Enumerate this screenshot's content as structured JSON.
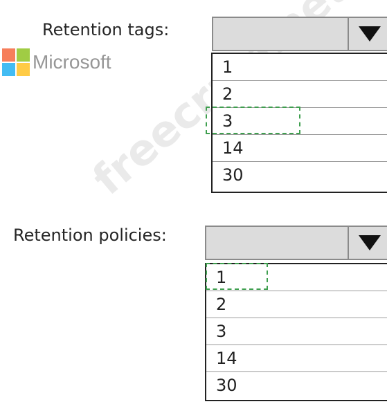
{
  "brand": {
    "text": "Microsoft"
  },
  "watermark": {
    "text": "freecram.net"
  },
  "retention_tags": {
    "label": "Retention tags:",
    "selected": "",
    "options": [
      "1",
      "2",
      "3",
      "14",
      "30"
    ],
    "highlighted": "3"
  },
  "retention_policies": {
    "label": "Retention policies:",
    "selected": "",
    "options": [
      "1",
      "2",
      "3",
      "14",
      "30"
    ],
    "highlighted": "1"
  },
  "colors": {
    "highlight_border": "#3f9f4f",
    "combo_bg": "#dcdcdc"
  }
}
